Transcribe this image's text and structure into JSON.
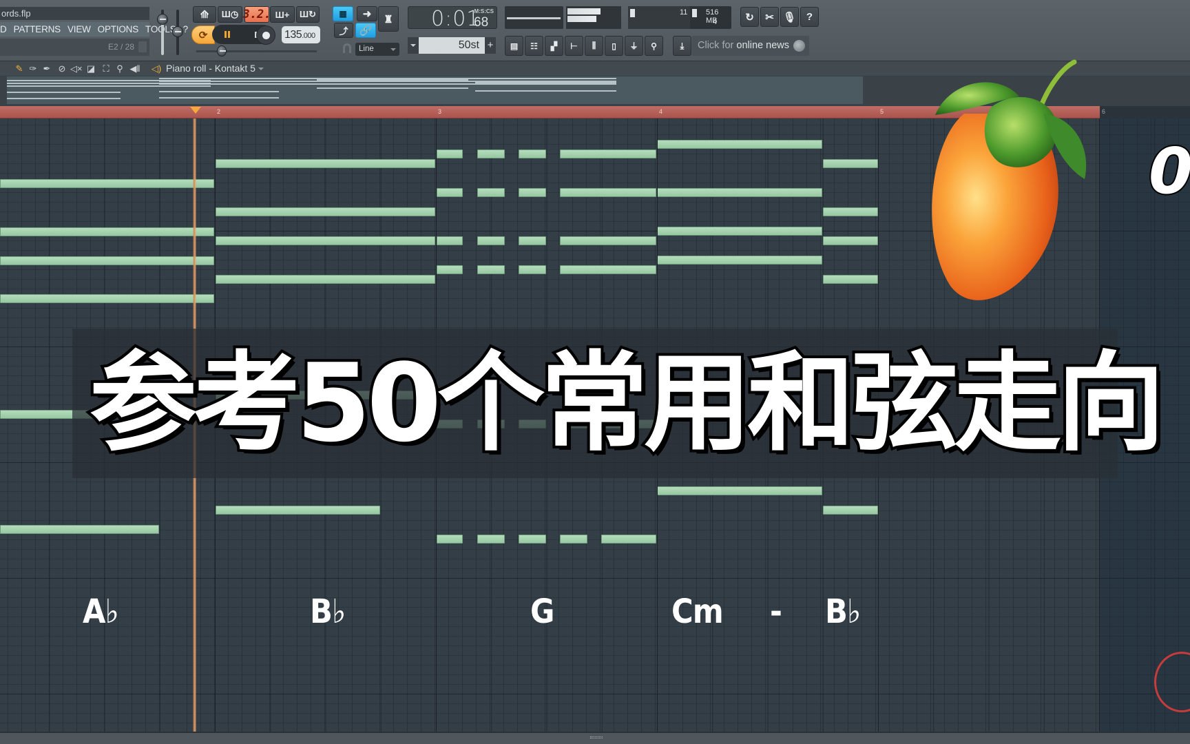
{
  "app": {
    "project_file": "ords.flp",
    "menu": [
      "D",
      "PATTERNS",
      "VIEW",
      "OPTIONS",
      "TOOLS",
      "?"
    ],
    "hint": "E2 / 28"
  },
  "transport": {
    "pattern_mode_display": "3.2.",
    "tempo_integer": "135",
    "tempo_decimal": ".000",
    "time_display": "0:01",
    "time_centiseconds": "68",
    "time_format_label": "M:S:CS",
    "snap_mode": "Line",
    "step_value": "50st",
    "plus_label": "+",
    "cpu_value": "11",
    "memory": "516 MB",
    "polyphony": "4",
    "news_prefix": "Click for",
    "news_suffix": "online news"
  },
  "piano_roll": {
    "title": "Piano roll - Kontakt 5",
    "tools": [
      "pencil-icon",
      "paint-icon",
      "delete-icon",
      "mute-icon",
      "mute-speaker-icon",
      "slice-icon",
      "select-icon",
      "zoom-icon",
      "playback-icon"
    ],
    "bar_numbers": [
      "2",
      "3",
      "4",
      "5",
      "6"
    ],
    "playhead_bar_position": 1.91,
    "chords": [
      {
        "label": "A♭",
        "bar": 1
      },
      {
        "label": "B♭",
        "bar": 2
      },
      {
        "label": "G",
        "bar": 3
      },
      {
        "label": "Cm",
        "bar": 4
      },
      {
        "label": "-",
        "bar": 4.6
      },
      {
        "label": "B♭",
        "bar": 4.7
      }
    ]
  },
  "overlay": {
    "title": "参考50个常用和弦走向",
    "side_number": "0"
  },
  "colors": {
    "note": "#a8d4b2",
    "ruler": "#b35f58",
    "grid": "#343e47",
    "playhead": "#f4a93b",
    "accent_blue": "#2fb4ee",
    "accent_orange": "#f6a73a"
  }
}
